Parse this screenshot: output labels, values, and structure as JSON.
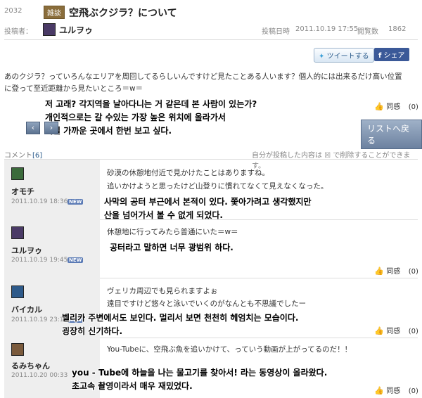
{
  "post": {
    "number": "2032",
    "category": "雑談",
    "title": "空飛ぶクジラ？について",
    "poster_label": "投稿者：",
    "poster_name": "ユルヲゥ",
    "date_label": "投稿日時",
    "date": "2011.10.19 17:55",
    "views_label": "閲覧数",
    "views": "1862",
    "tweet_label": "ツイートする",
    "share_label": "シェア",
    "body_line1": "あのクジラ？っていろんなエリアを周回してるらしいんですけど見たことある人います？個人的には出来るだけ高い位置",
    "body_line2": "に登って至近距離から見たいところ＝w＝",
    "like_label": "同感",
    "like_count": "(0)",
    "list_back_label": "リストへ戻る"
  },
  "translation_post": {
    "line1": "저 고래? 각지역을 날아다니는 거 같은데 본 사람이 있는가?",
    "line2": "개인적으로는 갈 수있는 가장 높은 위치에 올라가서",
    "line3": "제일 가까운 곳에서 한번 보고 싶다."
  },
  "comments_header": {
    "label": "コメント",
    "count": "[6]",
    "note": "自分が投稿した内容は ☒ で削除することができます。"
  },
  "comments": [
    {
      "name": "オモチ",
      "date": "2011.10.19 18:36",
      "new": "NEW",
      "line1": "砂漠の休憩地付近で見かけたことはありますね。",
      "line2": "追いかけようと思ったけど山登りに慣れてなくて見えなくなった。",
      "ko1": "사막의 공터 부근에서 본적이 있다. 쫓아가려고 생각했지만",
      "ko2": "산을 넘어가서 볼 수 없게 되었다.",
      "like": "同感",
      "like_count": "(0)"
    },
    {
      "name": "ユルヲゥ",
      "date": "2011.10.19 19:45",
      "new": "NEW",
      "line1": "休憩地に行ってみたら普通にいた＝w＝",
      "ko1": "공터라고 말하면 너무 광범위 하다.",
      "like": "同感",
      "like_count": "(0)"
    },
    {
      "name": "バイカル",
      "date": "2011.10.19 23:16",
      "new": "NEW",
      "line1": "ヴェリカ周辺でも見られますよぉ",
      "line2": "遠目ですけど悠々と泳いでいくのがなんとも不思議でしたー",
      "ko1": "벨리카 주변에서도 보인다. 멀리서 보면 천천히 헤엄치는 모습이다.",
      "ko2": "굉장히 신기하다.",
      "like": "同感",
      "like_count": "(0)"
    },
    {
      "name": "るみちゃん",
      "date": "2011.10.20 00:33",
      "line1": "You-Tubeに、空飛ぶ魚を追いかけて、っていう動画が上がってるのだ！！",
      "ko1": "you - Tube에 하늘을 나는 물고기를 찾아서! 라는 동영상이 올라왔다.",
      "ko2": "초고속 촬영이라서 매우 재밌었다.",
      "like": "同感",
      "like_count": "(0)"
    }
  ],
  "icons": {
    "like": "thumbs-up-icon",
    "prev": "chevron-left-icon",
    "next": "chevron-right-icon",
    "facebook": "facebook-icon",
    "twitter": "twitter-icon"
  }
}
